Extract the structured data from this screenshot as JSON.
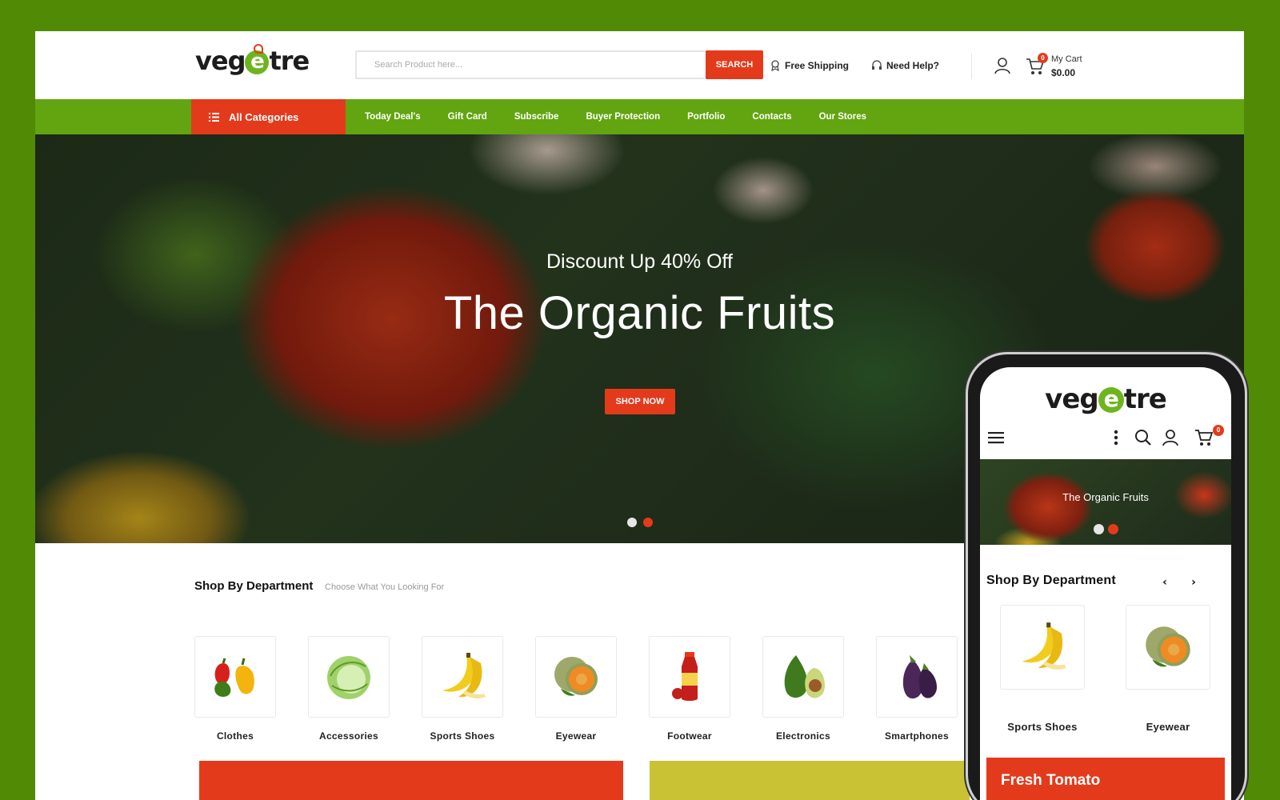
{
  "brand": {
    "name_prefix": "veg",
    "name_accent": "e",
    "name_suffix": "tre",
    "accent_color": "#6db51f",
    "primary_red": "#e43a1c",
    "nav_green": "#62a510"
  },
  "search": {
    "placeholder": "Search Product here...",
    "button_label": "SEARCH"
  },
  "header": {
    "free_shipping": "Free Shipping",
    "need_help": "Need Help?",
    "cart_title": "My Cart",
    "cart_total": "$0.00",
    "cart_count": "0"
  },
  "nav": {
    "all_categories": "All Categories",
    "items": [
      "Today Deal's",
      "Gift Card",
      "Subscribe",
      "Buyer Protection",
      "Portfolio",
      "Contacts",
      "Our Stores"
    ]
  },
  "hero": {
    "subtitle": "Discount Up 40% Off",
    "title": "The Organic Fruits",
    "button_label": "SHOP NOW",
    "slides": 2,
    "active_slide": 2
  },
  "department": {
    "title": "Shop By Department",
    "subtitle": "Choose What You Looking For",
    "items": [
      {
        "label": "Clothes",
        "icon": "bell-peppers-icon"
      },
      {
        "label": "Accessories",
        "icon": "cabbage-icon"
      },
      {
        "label": "Sports Shoes",
        "icon": "banana-icon"
      },
      {
        "label": "Eyewear",
        "icon": "melon-icon"
      },
      {
        "label": "Footwear",
        "icon": "juice-bottle-icon"
      },
      {
        "label": "Electronics",
        "icon": "avocado-icon"
      },
      {
        "label": "Smartphones",
        "icon": "eggplant-icon"
      }
    ]
  },
  "mobile": {
    "cart_count": "0",
    "hero_title": "The Organic Fruits",
    "department_title": "Shop By Department",
    "products": [
      {
        "label": "Sports Shoes",
        "icon": "banana-icon"
      },
      {
        "label": "Eyewear",
        "icon": "melon-icon"
      }
    ],
    "banner_title": "Fresh Tomato"
  }
}
